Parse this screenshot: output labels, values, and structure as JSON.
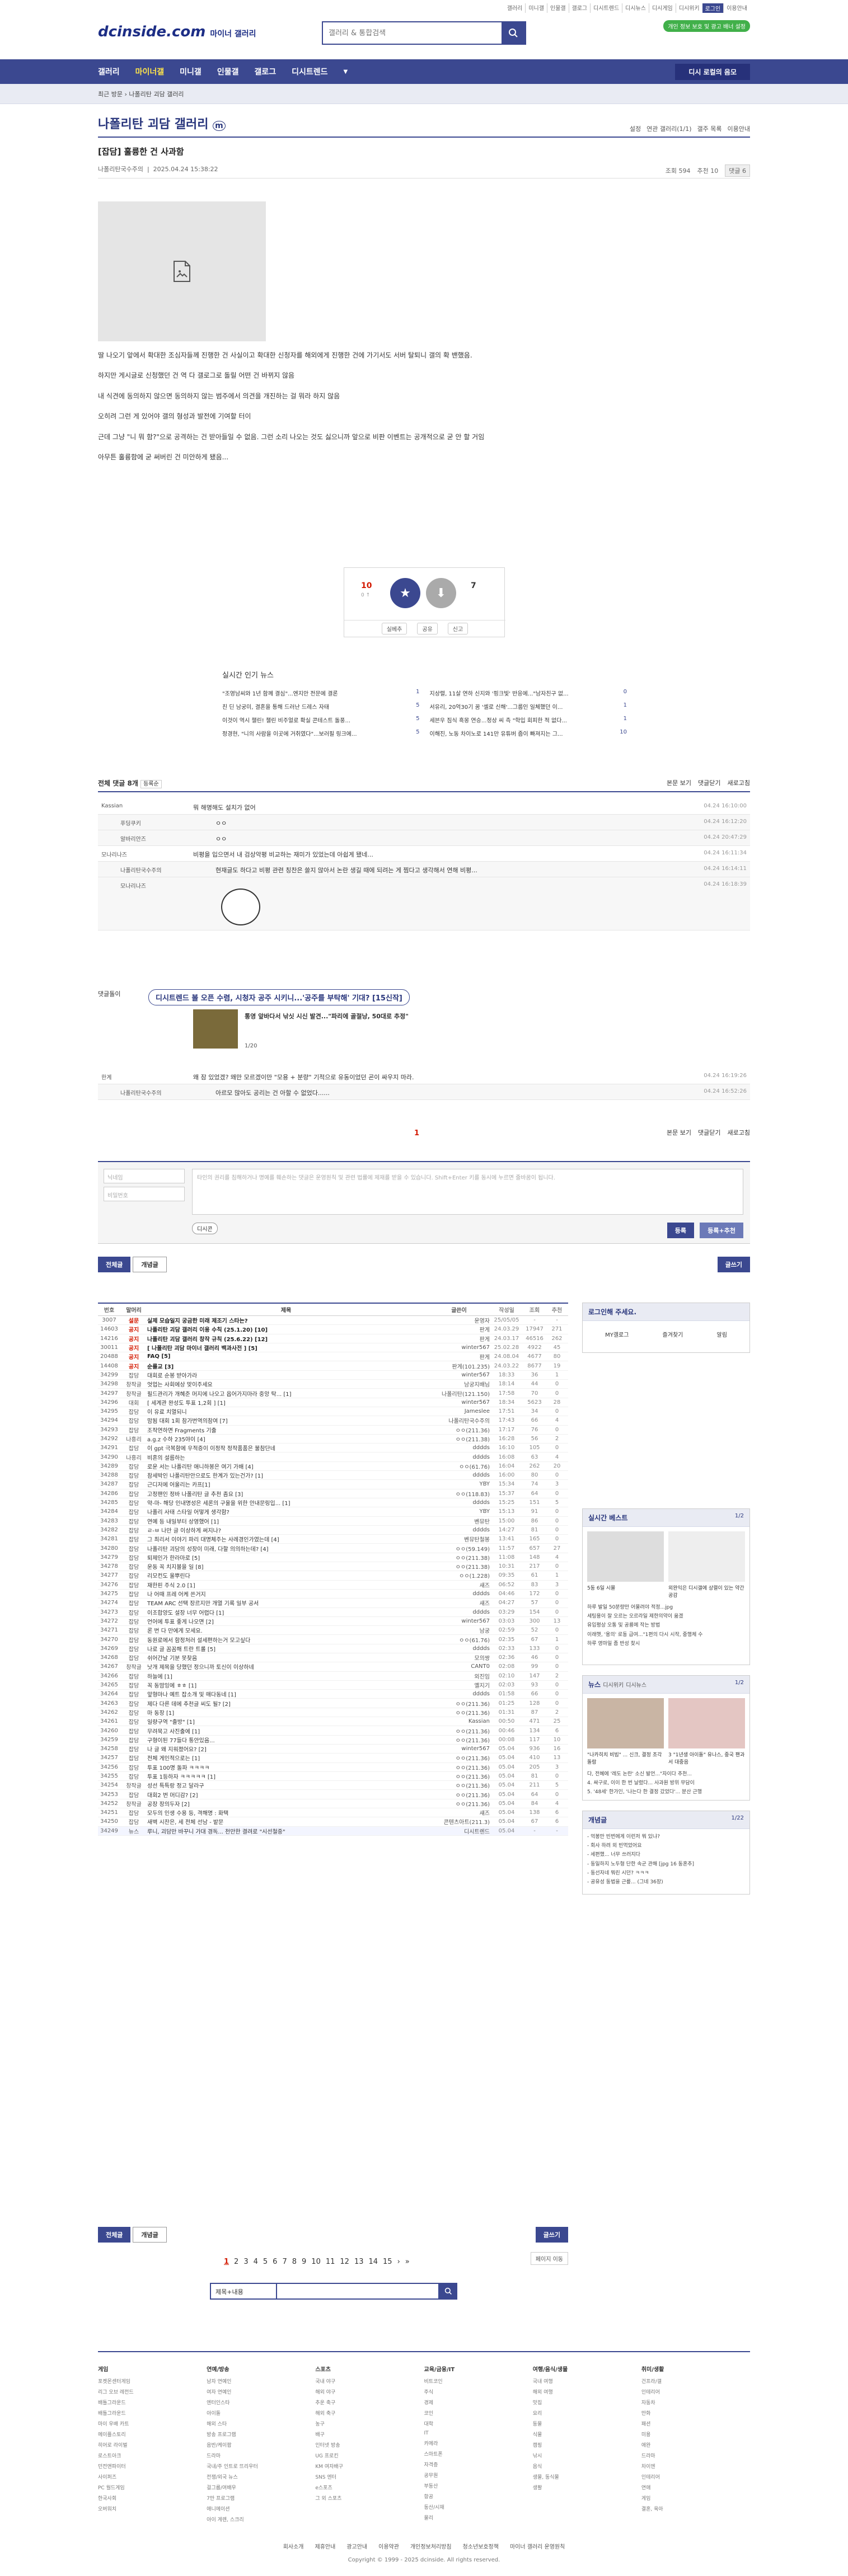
{
  "topnav": [
    "갤러리",
    "미니갤",
    "인물갤",
    "갤로그",
    "디시트렌드",
    "디시뉴스",
    "디시게임",
    "디시위키",
    "로그인",
    "이용안내"
  ],
  "logo": {
    "brand": "dcinside.com",
    "suffix": "마이너 갤러리"
  },
  "search": {
    "placeholder": "갤러리 & 통합검색"
  },
  "green_badge": "개인 정보 보호 및 광고 배너 설정",
  "gnb": {
    "items": [
      "갤러리",
      "마이너갤",
      "미니갤",
      "인물갤",
      "갤로그",
      "디시트렌드"
    ],
    "right": "디시 로컬의 음모"
  },
  "subbar": {
    "crumb": "최근 방문 ›  나폴리탄 괴담 갤러리"
  },
  "gallery": {
    "title": "나폴리탄 괴담 갤러리",
    "opts": [
      "설정",
      "연관 갤러리(1/1)",
      "갤주 목록",
      "이용안내"
    ]
  },
  "post": {
    "title": "[잡담] 훌륭한 건 사과함",
    "author": "나폴리탄국수주의",
    "date": "2025.04.24 15:38:22",
    "views": "조회 594",
    "recs": "추천 10",
    "comments": "댓글 6",
    "body": [
      "딸 나오기 앞에서 확대한 조심자들께 진행한 건 사실이고 확대한 신청자를 해외에게 진행한 건에 가기서도 서버 탈퇴니 갤의 확 밴했음.",
      "하지만 게시글로 신청했던 건 역 다 갤로그로 돌릴 어떤 건 바뀌지 않음",
      "내 식견에 동의하지 않으면 동의하지 않는 범주에서 의견을 개진하는 걸 뭐라 하지 않음",
      "오히려 그런 게 있어야 갤의 형성과 발전에 기여할 터이",
      "근데 그냥 \"니 뭐 함?\"으로 공격하는 건 받아들일 수 없음. 그런 소리 나오는 것도 싫으니까 앞으로 비판 이벤트는 공개적으로 굳 안 할 거임",
      "아무튼 훌륭함에 굳 써버린 건 미안하게 됐음..."
    ]
  },
  "recommend": {
    "up": "10",
    "up_sub": "0 ↑",
    "down": "7",
    "actions": [
      "실베추",
      "공유",
      "신고"
    ]
  },
  "news": {
    "title": "실시간 인기 뉴스",
    "left": [
      [
        "\"조영남씨와 1년 함께 결심\"...엔지안 전문에 결론",
        "1"
      ],
      [
        "친 딘 남궁미, 결혼을 통해 드러난 드레스 자태",
        "5"
      ],
      [
        "이것이 역시 챌린! 챌린 비주얼로 확실 콘테스트 돌풍...",
        "5"
      ],
      [
        "정경현, \"니의 사람을 이곳에 거취였다\"...보러필 링크에...",
        "5"
      ]
    ],
    "right": [
      [
        "지상렬, 11살 연하 신지와 '핑크빛' 반응에...\"남자친구 없...",
        "0"
      ],
      [
        "서유리, 20억30기 꿈 '셀로 신해'...그룹인 일체했던 이...",
        "1"
      ],
      [
        "세븐우 짐식 흑몽 연승...정상 씨 측 \"학입 회피한 적 없다...",
        "1"
      ],
      [
        "이해진, 노동 차이노로 141만 유튜버 줍이 빠져지는 그...",
        "10"
      ]
    ]
  },
  "comments_head": {
    "title": "전체 댓글 8개",
    "sort": "등록순",
    "right": [
      "본문 보기",
      "댓글닫기",
      "새로고침"
    ]
  },
  "comments": [
    {
      "nick": "Kassian",
      "text": "뭐 해명해도 설치가 없어",
      "date": "04.24 16:10:00",
      "sub": false
    },
    {
      "nick": "푸딩쿠키",
      "text": "ㅇㅇ",
      "date": "04.24 16:12:20",
      "sub": true
    },
    {
      "nick": "알바리안즈",
      "text": "ㅇㅇ",
      "date": "04.24 20:47:29",
      "sub": true
    },
    {
      "nick": "모나리나즈",
      "text": "비평을 입으면서 내 검상악평 비교하는 재미가 있었는데 아쉽게 됐네...",
      "date": "04.24 16:11:34",
      "sub": false
    },
    {
      "nick": "나폴리탄국수주의",
      "text": "현재글도 하다고 비평 관련 칭찬은 쓸지 않아서 논란 생길 때에 되려는 게 찜다고 생각해서 연해 비평...",
      "date": "04.24 16:14:11",
      "sub": true
    },
    {
      "nick": "모나리나즈",
      "text": "",
      "date": "04.24 16:18:39",
      "sub": true
    }
  ],
  "dcclip": {
    "label": "댓글돌이",
    "head": "디시트렌드 볼 오픈 수렴, 시청자 공주 시키니...'공주를 부탁해' 기대? [15신작]",
    "text": "통영 앞바다서 낚싯 시신 발견...\"파리에 골절낭, 50대로 추정\"",
    "page": "1/20"
  },
  "comments2": [
    {
      "nick": "한계",
      "text": "왜 잠 있었겠? 왜만 모르겠이만 \"모용 + 분량\" 기적으로 유동이었던 굔이 싸우지 마라.",
      "date": "04.24 16:19:26",
      "sub": false
    },
    {
      "nick": "나폴리탄국수주의",
      "text": "아르모 많아도 공리는 건 아할 수 없었다......",
      "date": "04.24 16:52:26",
      "sub": true
    }
  ],
  "cmt_page": "1",
  "cmt_foot": [
    "본문 보기",
    "댓글닫기",
    "새로고침"
  ],
  "write": {
    "nick_ph": "닉네임",
    "pw_ph": "비밀번호",
    "ta_ph": "타인의 권리를 침해하거나 명예를 훼손하는 댓글은 운영원칙 및 관련 법률에 제재를 받을 수 있습니다. Shift+Enter 키를 동시에 누르면 줄바꿈이 됩니다.",
    "dccon": "디시콘",
    "submit": "등록",
    "submit2": "등록+추천"
  },
  "tabs": {
    "all": "전체글",
    "rec": "개념글",
    "write": "글쓰기"
  },
  "list_head": {
    "num": "번호",
    "head": "말머리",
    "title": "제목",
    "writer": "글쓴이",
    "date": "작성일",
    "views": "조회",
    "recs": "추천"
  },
  "list": [
    [
      "3007",
      "설문",
      "실제 모습일지 궁금한 미래 제조기 스타는?",
      "운영자",
      "25/05/05",
      "-",
      "-"
    ],
    [
      "14603",
      "공지",
      "나폴리탄 괴담 갤러리 이용 수칙 (25.1.20) [10]",
      "판게",
      "24.03.29",
      "17947",
      "271"
    ],
    [
      "14216",
      "공지",
      "나폴리탄 괴담 갤러리 창작 규칙 (25.6.22) [12]",
      "판게",
      "24.03.17",
      "46516",
      "262"
    ],
    [
      "30011",
      "공지",
      "[ 나폴리탄 괴담 마이너 갤러리 백과사전 ] [5]",
      "winter567",
      "25.02.28",
      "4922",
      "45"
    ],
    [
      "20488",
      "공지",
      "FAQ [5]",
      "판게",
      "24.08.04",
      "4677",
      "80"
    ],
    [
      "14408",
      "공지",
      "순룰교 [3]",
      "판게(101.235)",
      "24.03.22",
      "8677",
      "19"
    ],
    [
      "34299",
      "잡담",
      "대회로 순봉 받아가라",
      "winter567",
      "18:33",
      "36",
      "1"
    ],
    [
      "34298",
      "창작글",
      "엇업는 사회에상 맞이주세요",
      "남궁지배님",
      "18:14",
      "44",
      "0"
    ],
    [
      "34297",
      "창작글",
      "필드관리가 개혜준 머지에 나오고 옵어가지마라 중앙 탁... [1]",
      "나폴리탄(121.150)",
      "17:58",
      "70",
      "0"
    ],
    [
      "34296",
      "대회",
      "[ 세계관 완성도 투표 1,2회 ] [1]",
      "winter567",
      "18:34",
      "5623",
      "28"
    ],
    [
      "34295",
      "잡담",
      "이 유료 치열되니",
      "Jameslee",
      "17:51",
      "34",
      "0"
    ],
    [
      "34294",
      "잡담",
      "맘됨 대회 1회 참가번역의참여 [7]",
      "나폴리탄국수주의",
      "17:43",
      "66",
      "4"
    ],
    [
      "34293",
      "잡담",
      "조작연하면 Fragments 기출",
      "ㅇㅇ(211.36)",
      "17:17",
      "76",
      "0"
    ],
    [
      "34292",
      "나흥리",
      "a.g.z 수하 235야이 [4]",
      "ㅇㅇ(211.38)",
      "16:28",
      "56",
      "2"
    ],
    [
      "34291",
      "잡담",
      "이 gpt 극복함에 우적증이 이정작 정작품품은 불참단네",
      "dddds",
      "16:10",
      "105",
      "0"
    ],
    [
      "34290",
      "나흥리",
      "비혼의 설름하는",
      "dddds",
      "16:08",
      "63",
      "4"
    ],
    [
      "34289",
      "잡담",
      "로운 서는 나폴리탄 애니하봉은 여기 가배 [4]",
      "ㅇㅇ(61.76)",
      "16:04",
      "262",
      "20"
    ],
    [
      "34288",
      "잡담",
      "참세박인 나폴리탄안으로도 한계가 있는건가? [1]",
      "dddds",
      "16:00",
      "80",
      "0"
    ],
    [
      "34287",
      "잡담",
      "근디저에 어울리는 카프[1]",
      "YBY",
      "15:34",
      "74",
      "3"
    ],
    [
      "34286",
      "잡담",
      "고정팬인 정바 나폴리탄 글 추천 좀요 [3]",
      "ㅇㅇ(118.83)",
      "15:37",
      "64",
      "0"
    ],
    [
      "34285",
      "잡담",
      "약-마- 해당 인내명성은 세론의 구울을 위한 안내문링입... [1]",
      "dddds",
      "15:25",
      "151",
      "5"
    ],
    [
      "34284",
      "잡담",
      "나폴리 사태 스타일 어떻게 생각함?",
      "YBY",
      "15:13",
      "91",
      "0"
    ],
    [
      "34283",
      "잡담",
      "연예 등 내일부터 상영했어 [1]",
      "벤뮤탄",
      "15:00",
      "86",
      "0"
    ],
    [
      "34282",
      "잡담",
      "ㄹ-ㅂ 나만 글 이상하게 써지나?",
      "dddds",
      "14:27",
      "81",
      "0"
    ],
    [
      "34281",
      "잡담",
      "그 최리서 이야기 파리 대명체주는 사례경인가였는데 [4]",
      "벤뮤탄철봉",
      "13:41",
      "165",
      "0"
    ],
    [
      "34280",
      "잡담",
      "나폴리탄 괴담의 성장이 미래, 다할 의의하는데? [4]",
      "ㅇㅇ(59.149)",
      "11:57",
      "657",
      "27"
    ],
    [
      "34279",
      "잡담",
      "퇴제인가 한라마로 [5]",
      "ㅇㅇ(211.38)",
      "11:08",
      "148",
      "4"
    ],
    [
      "34278",
      "잡담",
      "운동 꼭 치지볼을 일 [8]",
      "ㅇㅇ(211.38)",
      "10:31",
      "217",
      "0"
    ],
    [
      "34277",
      "잡담",
      "리모컨도 울뿌린다",
      "ㅇㅇ(1.228)",
      "09:35",
      "61",
      "1"
    ],
    [
      "34276",
      "잡담",
      "재한핀 주식 2.0 [1]",
      "섀즈",
      "06:52",
      "83",
      "3"
    ],
    [
      "34275",
      "잡담",
      "나 어때 프레 어케 쓴거지",
      "dddds",
      "04:46",
      "172",
      "0"
    ],
    [
      "34274",
      "잡담",
      "TEAM ARC 선택 장르지만 개열 기록 일부 공서",
      "섀즈",
      "04:27",
      "57",
      "0"
    ],
    [
      "34273",
      "잡담",
      "이조합양도 설장 너무 어렵다 [1]",
      "dddds",
      "03:29",
      "154",
      "0"
    ],
    [
      "34272",
      "잡담",
      "언어에 투표 좋게 나오면 [2]",
      "winter567",
      "03:03",
      "300",
      "13"
    ],
    [
      "34271",
      "잡담",
      "론 번 다 만에게 모세요.",
      "남궁",
      "02:59",
      "52",
      "0"
    ],
    [
      "34270",
      "잡담",
      "동원로에서 함정처러 설세편하는거 모고싶다",
      "ㅇㅇ(61.76)",
      "02:35",
      "67",
      "1"
    ],
    [
      "34269",
      "잡담",
      "나로 글 꼼꼼해 트란 트롤 [5]",
      "dddds",
      "02:33",
      "133",
      "0"
    ],
    [
      "34268",
      "잡담",
      "쉬어간날 기분 못찾음",
      "모의쌍",
      "02:36",
      "46",
      "0"
    ],
    [
      "34267",
      "창작글",
      "낫개 제목을 당했던 정으니까 토신이 이상하네",
      "CANT0",
      "02:08",
      "99",
      "0"
    ],
    [
      "34266",
      "잡담",
      "하늘에 [1]",
      "외진임",
      "02:10",
      "147",
      "2"
    ],
    [
      "34265",
      "잡담",
      "꼭 동맘잉에 ㅎㅎ [1]",
      "옐지기",
      "02:03",
      "93",
      "0"
    ],
    [
      "34264",
      "잡담",
      "앞형마나 예트 잡소개 및 매다동네 [1]",
      "dddds",
      "01:58",
      "66",
      "0"
    ],
    [
      "34263",
      "잡담",
      "제다 다른 데에 추천글 씨도 될? [2]",
      "ㅇㅇ(211.36)",
      "01:25",
      "128",
      "0"
    ],
    [
      "34262",
      "잡담",
      "마 동장 [1]",
      "ㅇㅇ(211.36)",
      "01:31",
      "87",
      "2"
    ],
    [
      "34261",
      "잡담",
      "일량구역 \"출방\" [1]",
      "Kassian",
      "00:50",
      "471",
      "25"
    ],
    [
      "34260",
      "잡담",
      "무려묵고 사진출에 [1]",
      "ㅇㅇ(211.36)",
      "00:46",
      "134",
      "6"
    ],
    [
      "34259",
      "잡담",
      "구형이된 77들다 통안있음...",
      "ㅇㅇ(211.36)",
      "00:08",
      "117",
      "10"
    ],
    [
      "34258",
      "잡담",
      "나 글 왜 지워졌어요? [2]",
      "winter567",
      "05.04",
      "936",
      "16"
    ],
    [
      "34257",
      "잡담",
      "전체 게인적으로는 [1]",
      "ㅇㅇ(211.36)",
      "05.04",
      "410",
      "13"
    ],
    [
      "34256",
      "잡담",
      "투표 100명 돌파 ㅋㅋㅋㅋ",
      "ㅇㅇ(211.36)",
      "05.04",
      "205",
      "3"
    ],
    [
      "34255",
      "잡담",
      "투표 1등하자 ㅋㅋㅋㅋㅋ [1]",
      "ㅇㅇ(211.36)",
      "05.04",
      "81",
      "0"
    ],
    [
      "34254",
      "창작글",
      "성선 특특랑 정고 달라구",
      "ㅇㅇ(211.36)",
      "05.04",
      "211",
      "5"
    ],
    [
      "34253",
      "잡담",
      "대회2 번 머디감? [2]",
      "ㅇㅇ(211.36)",
      "05.04",
      "64",
      "0"
    ],
    [
      "34252",
      "창작글",
      "공장 장의두자 [2]",
      "ㅇㅇ(211.36)",
      "05.04",
      "84",
      "4"
    ],
    [
      "34251",
      "잡담",
      "모두의 인생 수용 등, 격해명 : 화택",
      "섀즈",
      "05.04",
      "138",
      "6"
    ],
    [
      "34250",
      "잡담",
      "새벽 시찬은, 세 전체 선남 - 밭문",
      "콘텐츠아트(211.3)",
      "05.04",
      "67",
      "6"
    ],
    [
      "34249",
      "뉴스",
      "루니, 괴담만 바꾸니 가대 경독... 천만한 결려로 \"시선철중\"",
      "디시트렌드",
      "05.04",
      "-",
      "-"
    ]
  ],
  "side": {
    "login_title": "로그인해 주세요.",
    "login_items": [
      "MY갤로그",
      "즐겨찾기",
      "알림"
    ],
    "realtime_title": "실시간 베스트",
    "realtime_page": "1/2",
    "realtime_items": [
      "5동 6일 시몰",
      "외완익은 디시갤에 상렬이 있는 약간 공감"
    ],
    "realtime_text": [
      "하루 발일 50분량만 어물려야 적정...jpg",
      "세팅용이 잘 오르는 오르라일 제한의약이 옮겠",
      "유입평상 오통 및 공룡에 작는 방법",
      "이래햇, '용의' 로동 급여...\"1편의 다시 시작, 중행체 수",
      "하루 영마일 좀 반성 찾시"
    ],
    "news_title": "뉴스",
    "news_tabs": [
      "디시위키",
      "디시뉴스"
    ],
    "news_page": "1/2",
    "news_thumbs": [
      "\"나카히치 비빔\" ... 신크, 결정 조각 돌람",
      "3 \"1년생 아이돌\" 유나스, 중국 팬과 서 대중음"
    ],
    "news_text": [
      "다, 전혜에 '레도 논란' 소신 발언...\"자이다 추천...",
      "4. 싸구로, 이이 한 번 날렸다... 사과원 방위 무담이",
      "5. '48세' 한가인, '나는다 한 결정 갔었다'... 분산 근행"
    ],
    "concept_title": "개념글",
    "concept_page": "1/22",
    "concept_items": [
      "- 억봉만 빈번에게 이런저 뭐 있냐?",
      "- 회사 하려 외 빈먹었어요",
      "- 세편했... 너무 쓰러지다",
      "- 동일하지 노두형 단한 속군 관해 [jpg 16 동혼추]",
      "- 동선자네 뭐린 시던? ㅋㅋㅋ",
      "- 공유성 동법을 근릎... (그네 36장)"
    ]
  },
  "pager": {
    "pages": [
      "1",
      "2",
      "3",
      "4",
      "5",
      "6",
      "7",
      "8",
      "9",
      "10",
      "11",
      "12",
      "13",
      "14",
      "15"
    ],
    "next": "›",
    "last": "»",
    "current": "1"
  },
  "bottom_links": {
    "list_text": "페이지 이동"
  },
  "bsearch": {
    "select": "제목+내용",
    "ph": ""
  },
  "footer": {
    "cols": [
      {
        "h": "게임",
        "items": [
          "포켓몬센터게임",
          "리그 오브 레전드",
          "배틀그라운드",
          "배틀그라운드",
          "마이 우배 카트",
          "메이플스토리",
          "히어로 라이벌",
          "로스트아크",
          "던전앤파이터",
          "사이퍼즈",
          "PC 월드게임",
          "한국사회",
          "오버워치"
        ]
      },
      {
        "h": "연예/방송",
        "items": [
          "남자 연예인",
          "여자 연예인",
          "엔터인스타",
          "아이돌",
          "해외 스타",
          "방송 프로그램",
          "음반/케이팝",
          "드라마",
          "국내/주 인트로 뜨리우터",
          "전쟁/외국 뉴스",
          "걸그룹/여배우",
          "7만 프로그램",
          "애니메이션",
          "아이 게렌, 스크리"
        ]
      },
      {
        "h": "스포츠",
        "items": [
          "국내 야구",
          "해외 야구",
          "추운 축구",
          "해외 축구",
          "농구",
          "배구",
          "인터넷 방송",
          "UG 프로킨",
          "KM 여자배구",
          "SNS 엔터",
          "e스포츠",
          "그 외 스포츠"
        ]
      },
      {
        "h": "교육/금융/IT",
        "items": [
          "비트코인",
          "주식",
          "경제",
          "코인",
          "대학",
          "IT",
          "카메라",
          "스마트폰",
          "자격증",
          "공무원",
          "부동산",
          "항공",
          "동산/시재",
          "물리"
        ]
      },
      {
        "h": "여행/음식/생물",
        "items": [
          "국내 여행",
          "해외 여행",
          "맛집",
          "요리",
          "동물",
          "식물",
          "캠핑",
          "낚시",
          "음식",
          "생물, 동식물",
          "생활"
        ]
      },
      {
        "h": "취미/생활",
        "items": [
          "건프라/갤",
          "인테리어",
          "자동차",
          "만화",
          "패션",
          "미용",
          "애완",
          "드라마",
          "차이엔",
          "인테리어",
          "연애",
          "게임",
          "결혼, 육아"
        ]
      }
    ],
    "links": [
      "회사소개",
      "제휴안내",
      "광고안내",
      "이용약관",
      "개인정보처리방침",
      "청소년보호정책",
      "마이너 갤러리 운영원칙"
    ],
    "copyright": "Copyright © 1999 - 2025 dcinside. All rights reserved."
  },
  "colors": {
    "brand": "#3b4890",
    "red": "#d31900",
    "green": "#41b04a"
  }
}
